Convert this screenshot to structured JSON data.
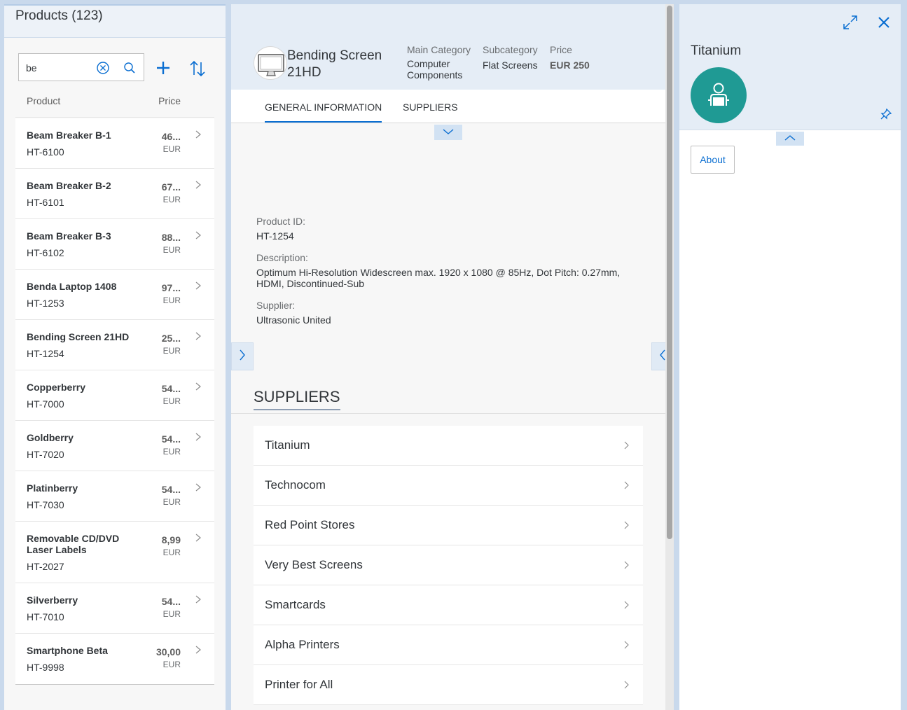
{
  "master": {
    "title": "Products (123)",
    "search_value": "be",
    "columns": {
      "product": "Product",
      "price": "Price"
    },
    "products": [
      {
        "name": "Beam Breaker B-1",
        "id": "HT-6100",
        "price": "46...",
        "currency": "EUR"
      },
      {
        "name": "Beam Breaker B-2",
        "id": "HT-6101",
        "price": "67...",
        "currency": "EUR"
      },
      {
        "name": "Beam Breaker B-3",
        "id": "HT-6102",
        "price": "88...",
        "currency": "EUR"
      },
      {
        "name": "Benda Laptop 1408",
        "id": "HT-1253",
        "price": "97...",
        "currency": "EUR"
      },
      {
        "name": "Bending Screen 21HD",
        "id": "HT-1254",
        "price": "25...",
        "currency": "EUR"
      },
      {
        "name": "Copperberry",
        "id": "HT-7000",
        "price": "54...",
        "currency": "EUR"
      },
      {
        "name": "Goldberry",
        "id": "HT-7020",
        "price": "54...",
        "currency": "EUR"
      },
      {
        "name": "Platinberry",
        "id": "HT-7030",
        "price": "54...",
        "currency": "EUR"
      },
      {
        "name": "Removable CD/DVD Laser Labels",
        "id": "HT-2027",
        "price": "8,99",
        "currency": "EUR"
      },
      {
        "name": "Silverberry",
        "id": "HT-7010",
        "price": "54...",
        "currency": "EUR"
      },
      {
        "name": "Smartphone Beta",
        "id": "HT-9998",
        "price": "30,00",
        "currency": "EUR"
      }
    ]
  },
  "detail": {
    "title": "Bending Screen 21HD",
    "main_category_label": "Main Category",
    "main_category_value": "Computer Components",
    "subcategory_label": "Subcategory",
    "subcategory_value": "Flat Screens",
    "price_label": "Price",
    "price_value": "EUR 250",
    "tabs": [
      "GENERAL INFORMATION",
      "SUPPLIERS"
    ],
    "product_id_label": "Product ID:",
    "product_id_value": "HT-1254",
    "description_label": "Description:",
    "description_value": "Optimum Hi-Resolution Widescreen max. 1920 x 1080 @ 85Hz, Dot Pitch: 0.27mm, HDMI, Discontinued-Sub",
    "supplier_label": "Supplier:",
    "supplier_value": "Ultrasonic United",
    "suppliers_section_title": "SUPPLIERS",
    "suppliers": [
      "Titanium",
      "Technocom",
      "Red Point Stores",
      "Very Best Screens",
      "Smartcards",
      "Alpha Printers",
      "Printer for All"
    ]
  },
  "side": {
    "title": "Titanium",
    "about_label": "About"
  },
  "colors": {
    "accent": "#0a6ed1",
    "avatar_bg": "#1f9a94",
    "header_bg": "#e5edf6"
  }
}
